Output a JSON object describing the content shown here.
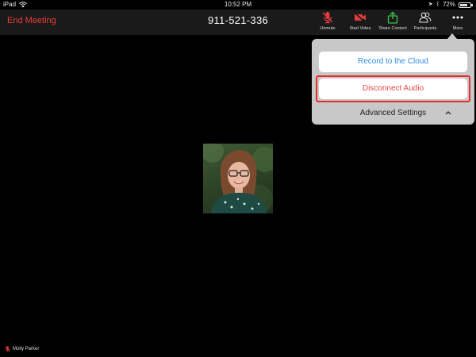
{
  "status_bar": {
    "device": "iPad",
    "time": "10:52 PM",
    "battery": "72%",
    "battery_level": 0.72
  },
  "toolbar": {
    "end_meeting": "End Meeting",
    "meeting_id": "911-521-336",
    "buttons": [
      {
        "label": "Unmute",
        "icon": "muted-mic-icon"
      },
      {
        "label": "Start Video",
        "icon": "video-off-icon"
      },
      {
        "label": "Share Content",
        "icon": "share-icon"
      },
      {
        "label": "Participants",
        "icon": "participants-icon"
      },
      {
        "label": "More",
        "icon": "more-dots-icon"
      }
    ]
  },
  "more_menu": {
    "record_cloud": "Record to the Cloud",
    "disconnect_audio": "Disconnect Audio",
    "advanced_settings": "Advanced Settings"
  },
  "participant": {
    "name": "Molly Parker"
  },
  "colors": {
    "end_meeting": "#ee3b3b",
    "record_link": "#2d8ce6",
    "highlight_border": "#e52f2f",
    "menu_bg": "#c8c8c8",
    "share_green": "#3cc24a"
  }
}
